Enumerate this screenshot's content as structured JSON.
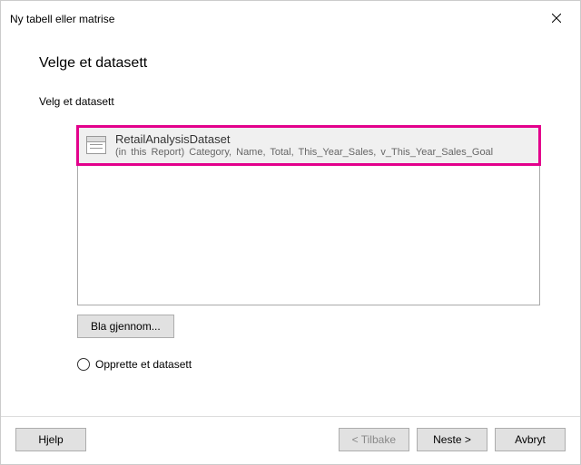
{
  "titlebar": {
    "title": "Ny tabell eller matrise"
  },
  "content": {
    "heading": "Velge et datasett",
    "section_label": "Velg et datasett"
  },
  "dataset": {
    "name": "RetailAnalysisDataset",
    "detail": "(in this Report) Category, Name, Total, This_Year_Sales, v_This_Year_Sales_Goal"
  },
  "buttons": {
    "browse": "Bla gjennom...",
    "help": "Hjelp",
    "back": "< Tilbake",
    "next": "Neste >",
    "cancel": "Avbryt"
  },
  "radio": {
    "create_label": "Opprette et datasett"
  }
}
